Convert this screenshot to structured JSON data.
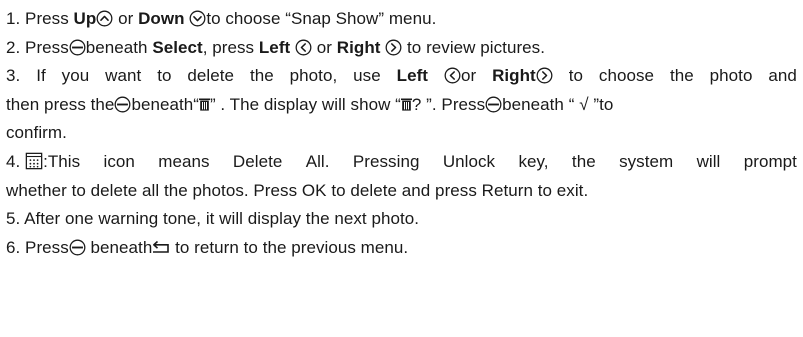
{
  "lines": {
    "l1": {
      "a": "1. Press ",
      "b": "Up",
      "c": " or ",
      "d": "Down",
      "e": "to choose “Snap Show” menu."
    },
    "l2": {
      "a": "2. Press",
      "b": "beneath ",
      "c": "Select",
      "d": ", press ",
      "e": "Left",
      "f": " or ",
      "g": "Right",
      "h": " to review pictures."
    },
    "l3": {
      "w1": "3.",
      "w2": "If",
      "w3": "you",
      "w4": "want",
      "w5": "to",
      "w6": "delete",
      "w7": "the",
      "w8": "photo,",
      "w9": "use",
      "w10": "Left",
      "w11": "or",
      "w12": "Right",
      "w13": "to",
      "w14": "choose",
      "w15": "the",
      "w16": "photo",
      "w17": "and"
    },
    "l4": {
      "w1": "then press the",
      "w2": "beneath“",
      "w3": "” . The display will show “",
      "w4": "? ”. Press",
      "w5": "beneath",
      "w6": "“ √ ”to"
    },
    "l5": {
      "a": "confirm."
    },
    "l6": {
      "w1": "4.",
      "w2": ":This",
      "w3": "icon",
      "w4": "means",
      "w5": "Delete",
      "w6": "All.",
      "w7": "Pressing",
      "w8": "Unlock",
      "w9": "key,",
      "w10": "the",
      "w11": "system",
      "w12": "will",
      "w13": "prompt"
    },
    "l7": {
      "a": "whether to delete all the photos. Press OK to delete and press Return to exit."
    },
    "l8": {
      "a": "5. After one warning tone, it will display the next photo."
    },
    "l9": {
      "a": "6. Press",
      "b": " beneath",
      "c": " to return to the previous menu."
    }
  },
  "icons": [
    "up-circle",
    "down-circle",
    "minus-circle",
    "left-circle",
    "right-circle",
    "trash",
    "delete-all-grid",
    "return-arrow"
  ],
  "colors": {
    "text": "#1a1a1a",
    "background": "#ffffff"
  }
}
